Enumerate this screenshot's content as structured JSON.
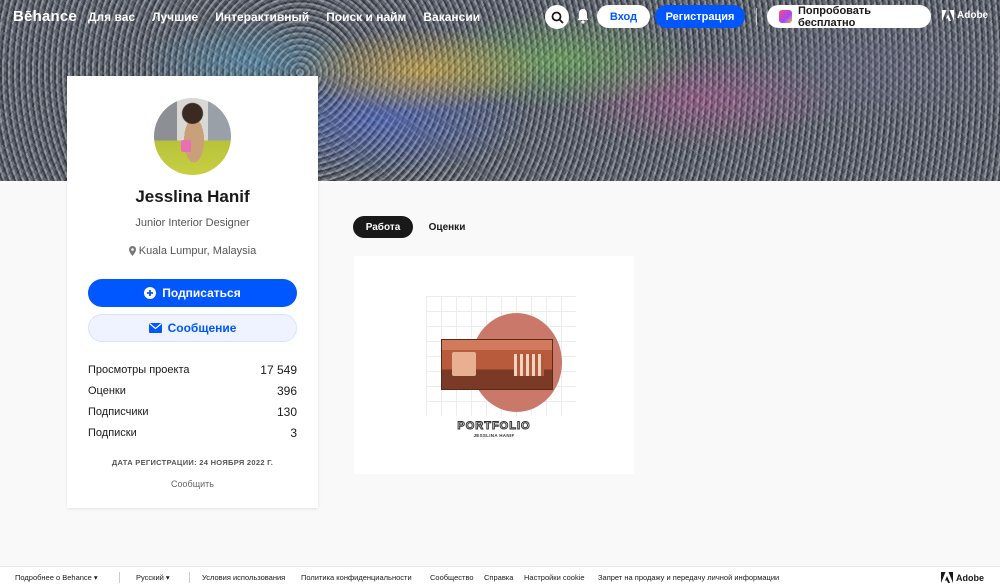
{
  "nav": {
    "logo": "Bēhance",
    "links": [
      "Для вас",
      "Лучшие",
      "Интерактивный",
      "Поиск и найм",
      "Вакансии"
    ],
    "login": "Вход",
    "register": "Регистрация",
    "try_free": "Попробовать бесплатно",
    "adobe": "Adobe"
  },
  "profile": {
    "name": "Jesslina Hanif",
    "title": "Junior Interior Designer",
    "location": "Kuala Lumpur, Malaysia",
    "follow": "Подписаться",
    "message": "Сообщение",
    "stats": [
      {
        "label": "Просмотры проекта",
        "value": "17 549"
      },
      {
        "label": "Оценки",
        "value": "396"
      },
      {
        "label": "Подписчики",
        "value": "130"
      },
      {
        "label": "Подписки",
        "value": "3"
      }
    ],
    "registered": "ДАТА РЕГИСТРАЦИИ: 24 НОЯБРЯ 2022 Г.",
    "report": "Сообщить"
  },
  "tabs": {
    "work": "Работа",
    "appreciations": "Оценки"
  },
  "project": {
    "title": "PORTFOLIO",
    "subtitle": "JESSLINA HANIF"
  },
  "footer": {
    "more": "Подробнее о Behance ▾",
    "language": "Русский ▾",
    "links": [
      "Условия использования",
      "Политика конфиденциальности",
      "Сообщество",
      "Справка",
      "Настройки cookie",
      "Запрет на продажу и передачу личной информации"
    ],
    "adobe": "Adobe"
  },
  "colors": {
    "accent": "#0057ff",
    "dark": "#191919"
  }
}
